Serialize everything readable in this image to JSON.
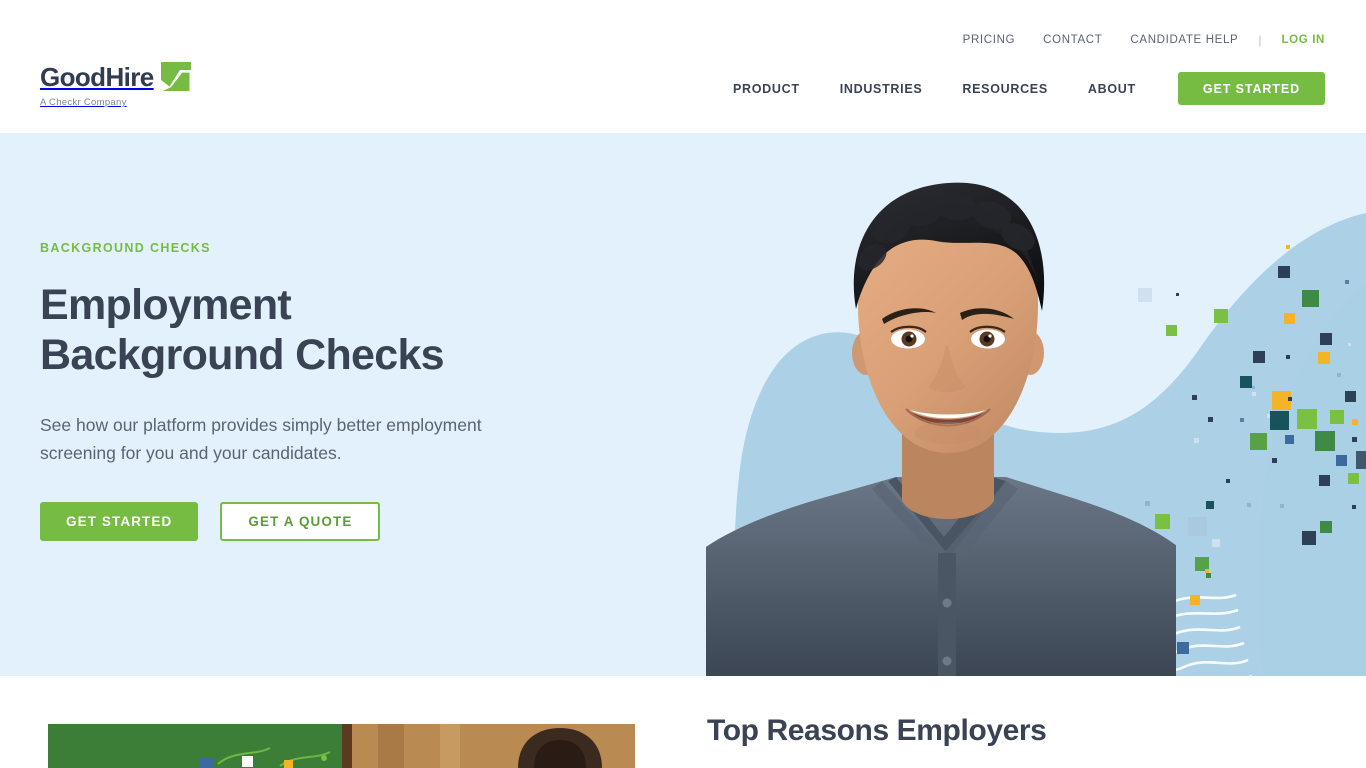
{
  "brand": {
    "name": "GoodHire",
    "tagline": "A Checkr Company",
    "logo_mark_icon": "green-square-checkmark-icon",
    "accent_green": "#76bc43",
    "dark_navy": "#3a4354",
    "hero_bg": "#e3f1fc",
    "blob_blue": "#a9cfe6"
  },
  "header": {
    "utility_nav": [
      {
        "label": "PRICING",
        "name": "utility-nav-pricing"
      },
      {
        "label": "CONTACT",
        "name": "utility-nav-contact"
      },
      {
        "label": "CANDIDATE HELP",
        "name": "utility-nav-candidate-help"
      }
    ],
    "divider": "|",
    "login_label": "LOG IN",
    "main_nav": [
      {
        "label": "PRODUCT",
        "name": "nav-product"
      },
      {
        "label": "INDUSTRIES",
        "name": "nav-industries"
      },
      {
        "label": "RESOURCES",
        "name": "nav-resources"
      },
      {
        "label": "ABOUT",
        "name": "nav-about"
      }
    ],
    "cta_label": "GET STARTED"
  },
  "hero": {
    "eyebrow": "BACKGROUND CHECKS",
    "title_line1": "Employment",
    "title_line2": "Background Checks",
    "subtitle": "See how our platform provides simply better employment screening for you and your candidates.",
    "primary_cta": "GET STARTED",
    "secondary_cta": "GET A QUOTE",
    "portrait_alt": "smiling-man-denim-shirt-portrait",
    "decor": {
      "squares_palette": [
        "#3f8a44",
        "#7ac143",
        "#f5b326",
        "#2d4057",
        "#1a5f5f",
        "#3d6a9e",
        "#bed8ea"
      ],
      "wavy_lines_color": "#ffffff"
    }
  },
  "section_2": {
    "heading": "Top Reasons Employers",
    "media_alt": "green-panel-and-person-photo"
  }
}
